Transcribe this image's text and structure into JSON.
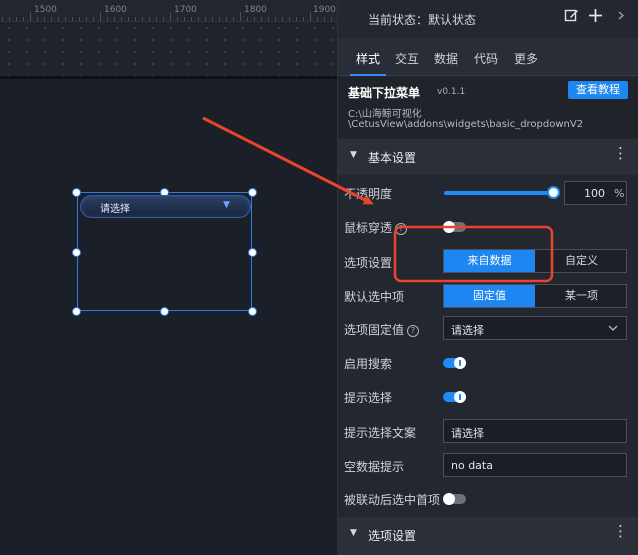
{
  "ruler": {
    "labels": [
      "1500",
      "1600",
      "1700",
      "1800",
      "1900"
    ]
  },
  "widget": {
    "text": "请选择",
    "arrow": "▼"
  },
  "panel": {
    "status": "当前状态：默认状态",
    "icons": {
      "edit": "edit-icon",
      "add": "plus-icon",
      "more": "chevron-right-icon"
    },
    "tabs": [
      "样式",
      "交互",
      "数据",
      "代码",
      "更多"
    ],
    "component": {
      "title": "基础下拉菜单",
      "version": "v0.1.1",
      "tutorial": "查看教程",
      "path_line1": "C:\\山海鲸可视化",
      "path_line2": "\\CetusView\\addons\\widgets\\basic_dropdownV2"
    },
    "basic_section": {
      "title": "基本设置"
    },
    "rows": {
      "opacity": {
        "label": "不透明度",
        "value": "100",
        "unit": "%",
        "level": 1.0
      },
      "mouse_through": {
        "label": "鼠标穿透",
        "on": false
      },
      "option_setting": {
        "label": "选项设置",
        "options": [
          "来自数据",
          "自定义"
        ],
        "selected": 0
      },
      "default_selected": {
        "label": "默认选中项",
        "options": [
          "固定值",
          "某一项"
        ],
        "selected": 0
      },
      "fixed_value": {
        "label": "选项固定值",
        "value": "请选择"
      },
      "enable_search": {
        "label": "启用搜索",
        "on": true
      },
      "prompt_select": {
        "label": "提示选择",
        "on": true
      },
      "prompt_text": {
        "label": "提示选择文案",
        "value": "请选择"
      },
      "empty_hint": {
        "label": "空数据提示",
        "value": "no data"
      },
      "linked_first": {
        "label": "被联动后选中首项",
        "on": false
      }
    },
    "option_section": {
      "title": "选项设置"
    }
  },
  "colors": {
    "accent": "#1e86f0",
    "annotation": "#e8452c"
  }
}
